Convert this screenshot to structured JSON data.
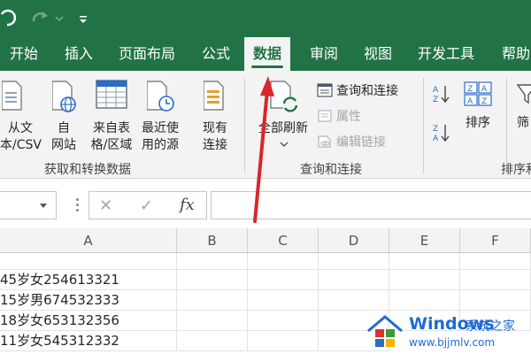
{
  "ribbon_tabs": [
    {
      "label": "开始"
    },
    {
      "label": "插入"
    },
    {
      "label": "页面布局"
    },
    {
      "label": "公式"
    },
    {
      "label": "数据"
    },
    {
      "label": "审阅"
    },
    {
      "label": "视图"
    },
    {
      "label": "开发工具"
    },
    {
      "label": "帮助"
    }
  ],
  "active_tab": "数据",
  "groups": {
    "get_transform": {
      "label": "获取和转换数据",
      "buttons": [
        {
          "line1": "从文",
          "line2": "本/CSV"
        },
        {
          "line1": "自",
          "line2": "网站"
        },
        {
          "line1": "来自表",
          "line2": "格/区域"
        },
        {
          "line1": "最近使",
          "line2": "用的源"
        },
        {
          "line1": "现有",
          "line2": "连接"
        }
      ]
    },
    "queries": {
      "label": "查询和连接",
      "refresh_all": "全部刷新",
      "query_connections": "查询和连接",
      "properties": "属性",
      "edit_links": "编辑链接"
    },
    "sort_filter": {
      "label": "排序和",
      "sort": "排序",
      "filter": "筛"
    }
  },
  "formula_bar": {
    "cancel_icon": "✕",
    "enter_icon": "✓",
    "fx_label": "fx"
  },
  "columns": [
    "A",
    "B",
    "C",
    "D",
    "E",
    "F"
  ],
  "rows": [
    "45岁女254613321",
    "15岁男674532333",
    "18岁女653132356",
    "11岁女545312332"
  ],
  "watermark": {
    "title": "Windows",
    "subtitle": "系统之家",
    "url": "www.bjjmlv.com"
  },
  "colors": {
    "excel_green": "#217346",
    "ribbon_bg": "#f3f3f3",
    "arrow_red": "#d9262b",
    "watermark_blue": "#1e6bd6"
  }
}
